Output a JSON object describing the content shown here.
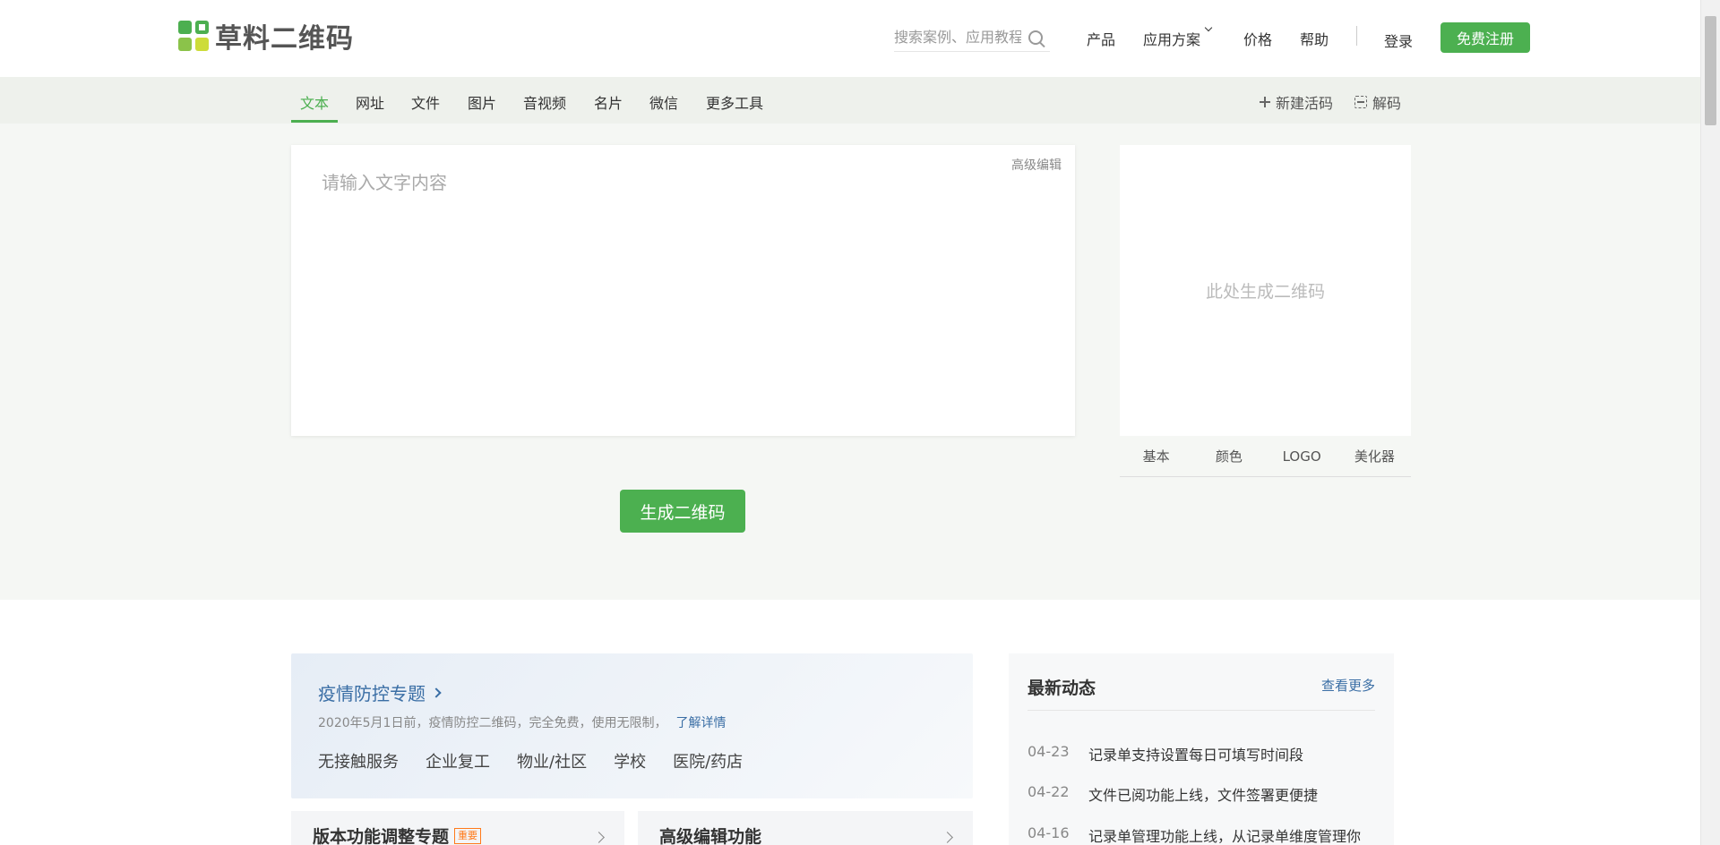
{
  "header": {
    "logo_text": "草料二维码",
    "search_placeholder": "搜索案例、应用教程",
    "nav": {
      "products": "产品",
      "solutions": "应用方案",
      "price": "价格",
      "help": "帮助",
      "login": "登录",
      "register": "免费注册"
    }
  },
  "subnav": {
    "tabs": [
      "文本",
      "网址",
      "文件",
      "图片",
      "音视频",
      "名片",
      "微信",
      "更多工具"
    ],
    "active_tab": "文本",
    "new_code": "新建活码",
    "decode": "解码"
  },
  "editor": {
    "placeholder": "请输入文字内容",
    "advanced_edit": "高级编辑",
    "generate_button": "生成二维码"
  },
  "qr_panel": {
    "placeholder": "此处生成二维码",
    "tabs": [
      "基本",
      "颜色",
      "LOGO",
      "美化器"
    ]
  },
  "epidemic": {
    "title": "疫情防控专题",
    "desc": "2020年5月1日前，疫情防控二维码，完全免费，使用无限制，",
    "link": "了解详情",
    "tags": [
      "无接触服务",
      "企业复工",
      "物业/社区",
      "学校",
      "医院/药店"
    ]
  },
  "features": [
    {
      "title": "版本功能调整专题",
      "badge": "重要"
    },
    {
      "title": "高级编辑功能",
      "badge": ""
    }
  ],
  "news": {
    "title": "最新动态",
    "more": "查看更多",
    "items": [
      {
        "date": "04-23",
        "text": "记录单支持设置每日可填写时间段"
      },
      {
        "date": "04-22",
        "text": "文件已阅功能上线，文件签署更便捷"
      },
      {
        "date": "04-16",
        "text": "记录单管理功能上线，从记录单维度管理你"
      }
    ]
  },
  "colors": {
    "brand_green": "#4cb050",
    "link_blue": "#3a6ea5",
    "badge_orange": "#ff7a1a"
  }
}
